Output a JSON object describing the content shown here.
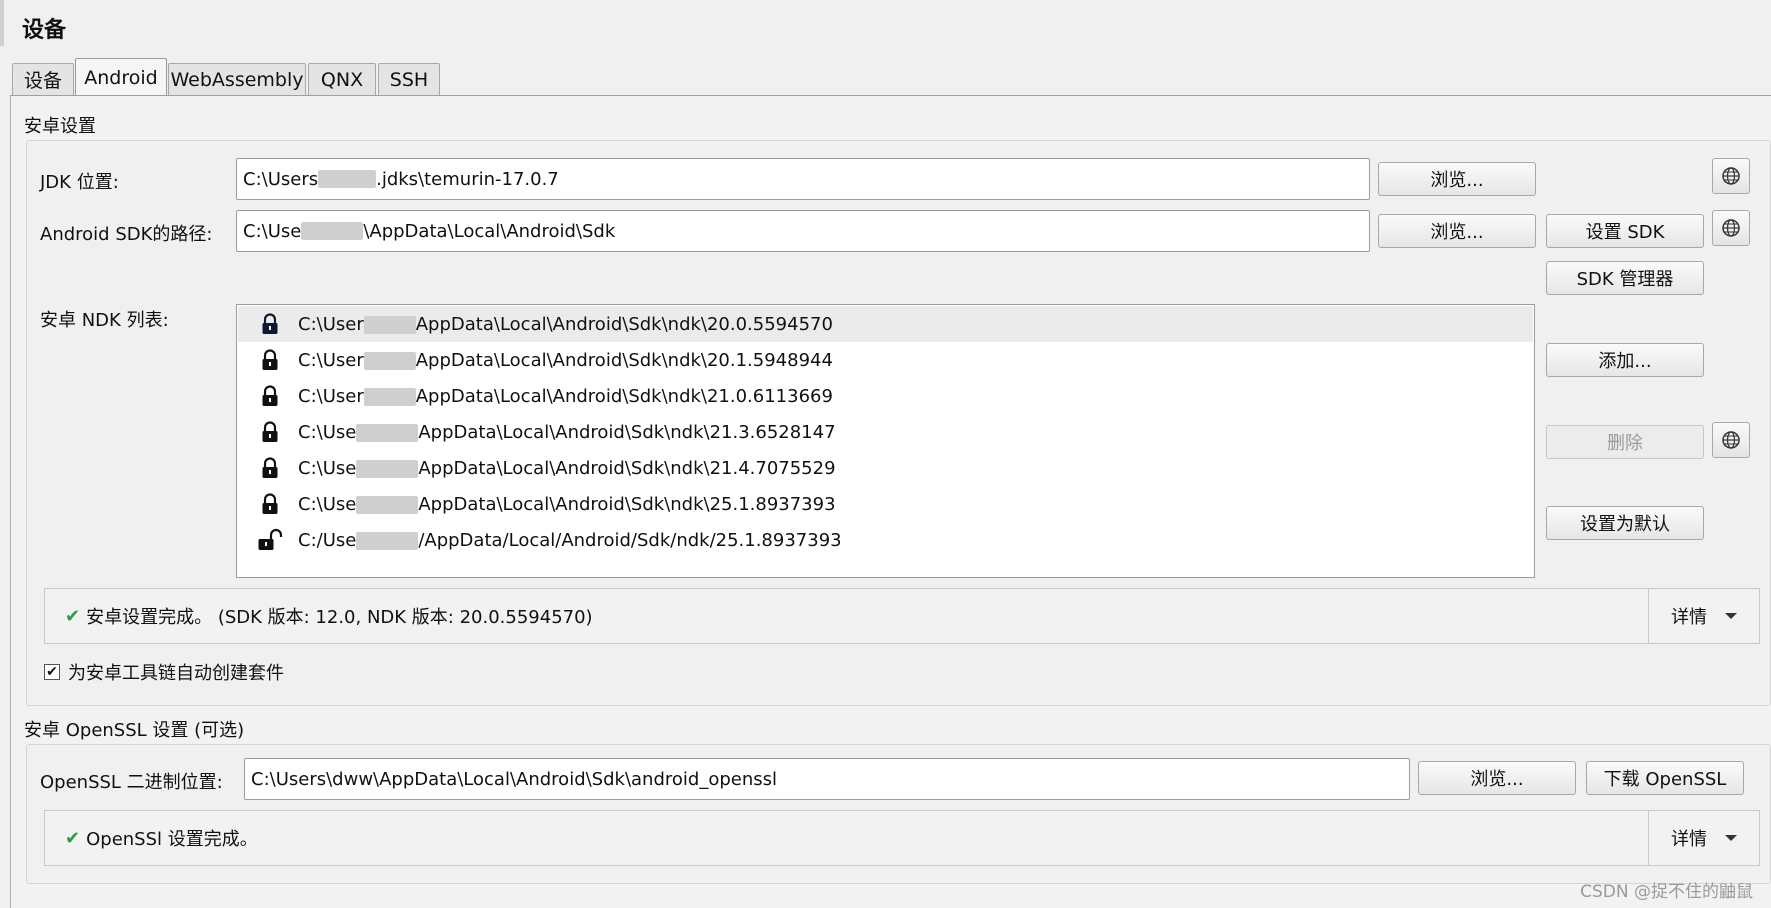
{
  "page": {
    "title": "设备"
  },
  "tabs": [
    {
      "label": "设备"
    },
    {
      "label": "Android"
    },
    {
      "label": "WebAssembly"
    },
    {
      "label": "QNX"
    },
    {
      "label": "SSH"
    }
  ],
  "android_settings": {
    "section_title": "安卓设置",
    "jdk": {
      "label": "JDK 位置:",
      "value_pre": "C:\\Users",
      "value_post": ".jdks\\temurin-17.0.7",
      "browse_label": "浏览..."
    },
    "sdk": {
      "label": "Android SDK的路径:",
      "value_pre": "C:\\Use",
      "value_post": "\\AppData\\Local\\Android\\Sdk",
      "browse_label": "浏览...",
      "setup_label": "设置 SDK",
      "manager_label": "SDK 管理器"
    },
    "ndk": {
      "label": "安卓 NDK 列表:",
      "items": [
        {
          "pre": "C:\\User",
          "post": "AppData\\Local\\Android\\Sdk\\ndk\\20.0.5594570",
          "locked": true
        },
        {
          "pre": "C:\\User",
          "post": "AppData\\Local\\Android\\Sdk\\ndk\\20.1.5948944",
          "locked": true
        },
        {
          "pre": "C:\\User",
          "post": "AppData\\Local\\Android\\Sdk\\ndk\\21.0.6113669",
          "locked": true
        },
        {
          "pre": "C:\\Use",
          "post": "AppData\\Local\\Android\\Sdk\\ndk\\21.3.6528147",
          "locked": true
        },
        {
          "pre": "C:\\Use",
          "post": "AppData\\Local\\Android\\Sdk\\ndk\\21.4.7075529",
          "locked": true
        },
        {
          "pre": "C:\\Use",
          "post": "AppData\\Local\\Android\\Sdk\\ndk\\25.1.8937393",
          "locked": true
        },
        {
          "pre": "C:/Use",
          "post": "/AppData/Local/Android/Sdk/ndk/25.1.8937393",
          "locked": false
        }
      ],
      "add_label": "添加...",
      "remove_label": "删除",
      "set_default_label": "设置为默认"
    },
    "status": {
      "message": "安卓设置完成。 (SDK 版本: 12.0, NDK 版本: 20.0.5594570)",
      "details_label": "详情"
    },
    "auto_create_kits": {
      "label": "为安卓工具链自动创建套件",
      "checked": true
    }
  },
  "openssl_settings": {
    "section_title": "安卓 OpenSSL 设置 (可选)",
    "binary": {
      "label": "OpenSSL 二进制位置:",
      "value": "C:\\Users\\dww\\AppData\\Local\\Android\\Sdk\\android_openssl",
      "browse_label": "浏览...",
      "download_label": "下载 OpenSSL"
    },
    "status": {
      "message": "OpenSSl 设置完成。",
      "details_label": "详情"
    }
  },
  "watermark": "CSDN @捉不住的鼬鼠",
  "colors": {
    "check": "#2e9a3c",
    "selected_row": "#ebebeb"
  },
  "icons": {
    "globe": "globe-icon",
    "lock": "lock-icon",
    "unlock": "unlock-icon",
    "check": "check-icon",
    "dropdown": "chevron-down-icon"
  }
}
